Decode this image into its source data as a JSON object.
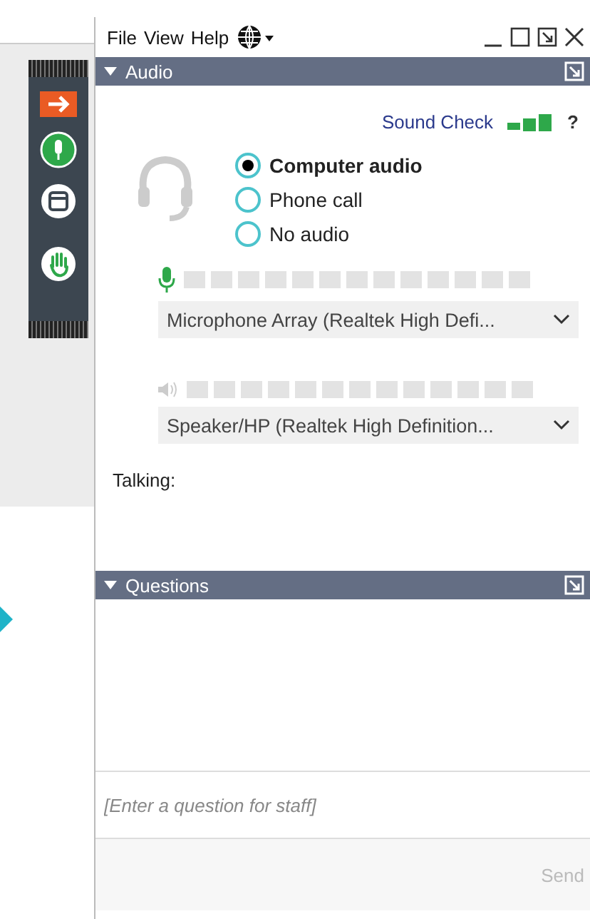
{
  "menu": {
    "items": [
      "File",
      "View",
      "Help"
    ]
  },
  "audio": {
    "title": "Audio",
    "expanded": true,
    "sound_check": "Sound Check",
    "help": "?",
    "options": [
      {
        "label": "Computer audio",
        "selected": true
      },
      {
        "label": "Phone call",
        "selected": false
      },
      {
        "label": "No audio",
        "selected": false
      }
    ],
    "microphone": {
      "device": "Microphone Array (Realtek High Defi..."
    },
    "speaker": {
      "device": "Speaker/HP (Realtek High Definition..."
    },
    "talking": "Talking:"
  },
  "questions": {
    "title": "Questions",
    "expanded": true,
    "placeholder": "[Enter a question for staff]",
    "send": "Send"
  }
}
